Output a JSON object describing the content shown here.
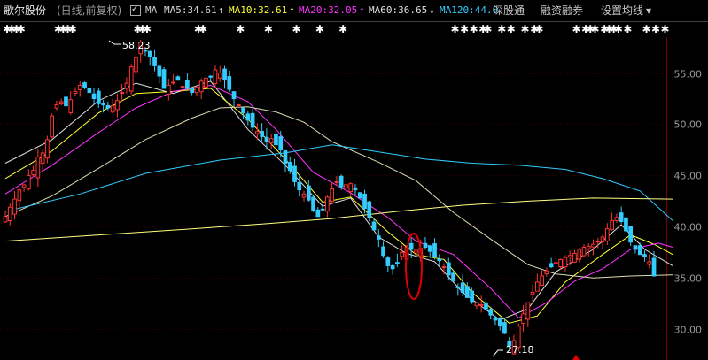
{
  "header": {
    "stock_name": "歌尔股份",
    "period": "(日线,前复权)",
    "ma_label": "MA",
    "ma5": "MA5:34.61",
    "ma10": "MA10:32.61",
    "ma20": "MA20:32.05",
    "ma60": "MA60:36.65",
    "ma120": "MA120:44.0",
    "up_arrow": "↑",
    "down_arrow": "↓",
    "shenguantong": "深股通",
    "rongzi": "融资融券",
    "settings": "设置均线",
    "settings_arrow": "▾"
  },
  "colors": {
    "up": "#ff3333",
    "down": "#33ccff",
    "ma5": "#e0e0e0",
    "ma10": "#ffff33",
    "ma20": "#ff33ff",
    "ma60": "#dcdcb4",
    "ma120": "#33ccff",
    "ma250": "#ffff80"
  },
  "chart_data": {
    "type": "candlestick",
    "ylim": [
      27,
      58.5
    ],
    "y_ticks": [
      "55.00",
      "50.00",
      "45.00",
      "40.00",
      "35.00",
      "30.00"
    ],
    "annotations": {
      "high": "58.23",
      "low": "27.18"
    },
    "star_marker": "✱",
    "closes": [
      41.0,
      41.9,
      42.7,
      43.6,
      44.1,
      45.0,
      45.5,
      46.8,
      47.2,
      48.5,
      50.8,
      51.9,
      52.2,
      51.8,
      52.4,
      53.2,
      53.8,
      53.6,
      53.1,
      52.5,
      52.0,
      51.9,
      51.6,
      51.8,
      52.3,
      53.1,
      54.0,
      55.6,
      56.5,
      58.0,
      57.2,
      56.6,
      55.7,
      54.7,
      53.5,
      53.8,
      54.1,
      54.3,
      53.7,
      53.5,
      53.1,
      53.6,
      54.2,
      54.5,
      54.6,
      55.3,
      55.0,
      54.3,
      53.4,
      52.5,
      51.9,
      51.1,
      50.4,
      49.7,
      49.3,
      48.8,
      48.3,
      48.6,
      48.0,
      47.5,
      46.2,
      45.5,
      44.4,
      43.6,
      43.2,
      42.6,
      41.6,
      41.0,
      41.7,
      42.9,
      43.7,
      44.4,
      43.9,
      44.1,
      44.2,
      43.6,
      42.8,
      41.8,
      40.9,
      39.7,
      38.8,
      37.2,
      36.2,
      35.9,
      36.4,
      37.5,
      38.0,
      37.8,
      37.7,
      37.9,
      38.0,
      37.6,
      37.1,
      36.7,
      36.1,
      35.3,
      34.7,
      34.1,
      33.6,
      33.1,
      32.7,
      32.6,
      32.4,
      32.0,
      31.4,
      30.9,
      30.4,
      29.6,
      28.4,
      28.9,
      30.3,
      31.5,
      32.6,
      33.6,
      34.6,
      35.2,
      35.7,
      36.1,
      36.5,
      36.8,
      37.0,
      37.2,
      37.4,
      37.8,
      38.0,
      38.1,
      38.3,
      38.6,
      39.0,
      39.8,
      40.6,
      40.9,
      40.5,
      39.6,
      38.5,
      37.8,
      37.3,
      37.1,
      36.6,
      35.2
    ],
    "ma_series": [
      {
        "name": "MA5",
        "color_key": "ma5",
        "points": [
          [
            0,
            46.2
          ],
          [
            10,
            48.5
          ],
          [
            20,
            52.3
          ],
          [
            28,
            54.0
          ],
          [
            36,
            53.0
          ],
          [
            44,
            54.2
          ],
          [
            52,
            49.5
          ],
          [
            60,
            46.0
          ],
          [
            68,
            42.0
          ],
          [
            74,
            42.8
          ],
          [
            80,
            39.0
          ],
          [
            86,
            37.4
          ],
          [
            92,
            36.6
          ],
          [
            98,
            33.6
          ],
          [
            106,
            30.9
          ],
          [
            112,
            32.0
          ],
          [
            118,
            35.6
          ],
          [
            126,
            37.8
          ],
          [
            132,
            40.2
          ],
          [
            137,
            37.8
          ],
          [
            143,
            36.2
          ]
        ]
      },
      {
        "name": "MA10",
        "color_key": "ma10",
        "points": [
          [
            0,
            44.7
          ],
          [
            10,
            47.4
          ],
          [
            20,
            51.1
          ],
          [
            28,
            53.0
          ],
          [
            36,
            53.2
          ],
          [
            44,
            53.5
          ],
          [
            52,
            50.5
          ],
          [
            60,
            46.6
          ],
          [
            68,
            42.4
          ],
          [
            74,
            42.9
          ],
          [
            82,
            39.5
          ],
          [
            88,
            37.3
          ],
          [
            94,
            36.8
          ],
          [
            100,
            33.6
          ],
          [
            108,
            30.6
          ],
          [
            114,
            31.3
          ],
          [
            120,
            34.6
          ],
          [
            128,
            37.3
          ],
          [
            134,
            39.2
          ],
          [
            139,
            38.3
          ],
          [
            143,
            37.3
          ]
        ]
      },
      {
        "name": "MA20",
        "color_key": "ma20",
        "points": [
          [
            0,
            43.2
          ],
          [
            10,
            46.0
          ],
          [
            20,
            49.2
          ],
          [
            28,
            51.6
          ],
          [
            36,
            53.2
          ],
          [
            44,
            53.8
          ],
          [
            52,
            52.2
          ],
          [
            58,
            49.5
          ],
          [
            66,
            45.3
          ],
          [
            74,
            43.3
          ],
          [
            82,
            40.9
          ],
          [
            88,
            38.6
          ],
          [
            96,
            37.3
          ],
          [
            104,
            34.0
          ],
          [
            110,
            31.1
          ],
          [
            116,
            32.6
          ],
          [
            122,
            34.7
          ],
          [
            128,
            35.9
          ],
          [
            134,
            37.8
          ],
          [
            140,
            38.4
          ],
          [
            143,
            38.0
          ]
        ]
      },
      {
        "name": "MA60",
        "color_key": "ma60",
        "points": [
          [
            0,
            41.0
          ],
          [
            10,
            43.0
          ],
          [
            20,
            45.7
          ],
          [
            30,
            48.5
          ],
          [
            40,
            50.6
          ],
          [
            46,
            51.6
          ],
          [
            52,
            51.7
          ],
          [
            58,
            51.2
          ],
          [
            64,
            50.2
          ],
          [
            70,
            48.3
          ],
          [
            80,
            46.3
          ],
          [
            88,
            44.5
          ],
          [
            96,
            41.4
          ],
          [
            104,
            38.8
          ],
          [
            112,
            36.3
          ],
          [
            118,
            35.4
          ],
          [
            126,
            35.0
          ],
          [
            134,
            35.2
          ],
          [
            143,
            35.3
          ]
        ]
      },
      {
        "name": "MA120",
        "color_key": "ma120",
        "points": [
          [
            0,
            41.5
          ],
          [
            16,
            43.2
          ],
          [
            30,
            45.2
          ],
          [
            46,
            46.5
          ],
          [
            60,
            47.2
          ],
          [
            70,
            48.0
          ],
          [
            80,
            47.3
          ],
          [
            90,
            46.6
          ],
          [
            100,
            46.2
          ],
          [
            110,
            46.0
          ],
          [
            120,
            45.6
          ],
          [
            128,
            44.7
          ],
          [
            136,
            43.5
          ],
          [
            143,
            40.6
          ]
        ]
      },
      {
        "name": "MA250",
        "color_key": "ma250",
        "points": [
          [
            0,
            38.6
          ],
          [
            20,
            39.2
          ],
          [
            40,
            39.8
          ],
          [
            56,
            40.3
          ],
          [
            70,
            40.8
          ],
          [
            84,
            41.5
          ],
          [
            98,
            42.1
          ],
          [
            112,
            42.5
          ],
          [
            126,
            42.8
          ],
          [
            143,
            42.7
          ]
        ]
      }
    ],
    "highlight_ellipse_index": 96
  }
}
